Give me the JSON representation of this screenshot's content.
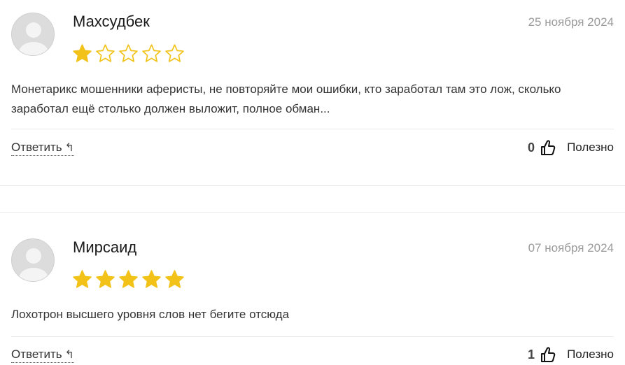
{
  "reviews": [
    {
      "name": "Махсудбек",
      "date": "25 ноября 2024",
      "rating": 1,
      "max_rating": 5,
      "text": "Монетарикс мошенники аферисты, не повторяйте мои ошибки, кто заработал там это лож, сколько заработал ещё столько должен выложит, полное обман...",
      "reply_label": "Ответить",
      "helpful_count": "0",
      "helpful_label": "Полезно"
    },
    {
      "name": "Мирсаид",
      "date": "07 ноября 2024",
      "rating": 5,
      "max_rating": 5,
      "text": "Лохотрон высшего уровня слов нет бегите отсюда",
      "reply_label": "Ответить",
      "helpful_count": "1",
      "helpful_label": "Полезно"
    }
  ],
  "colors": {
    "star_filled": "#f2c218",
    "star_outline": "#f2c218"
  }
}
